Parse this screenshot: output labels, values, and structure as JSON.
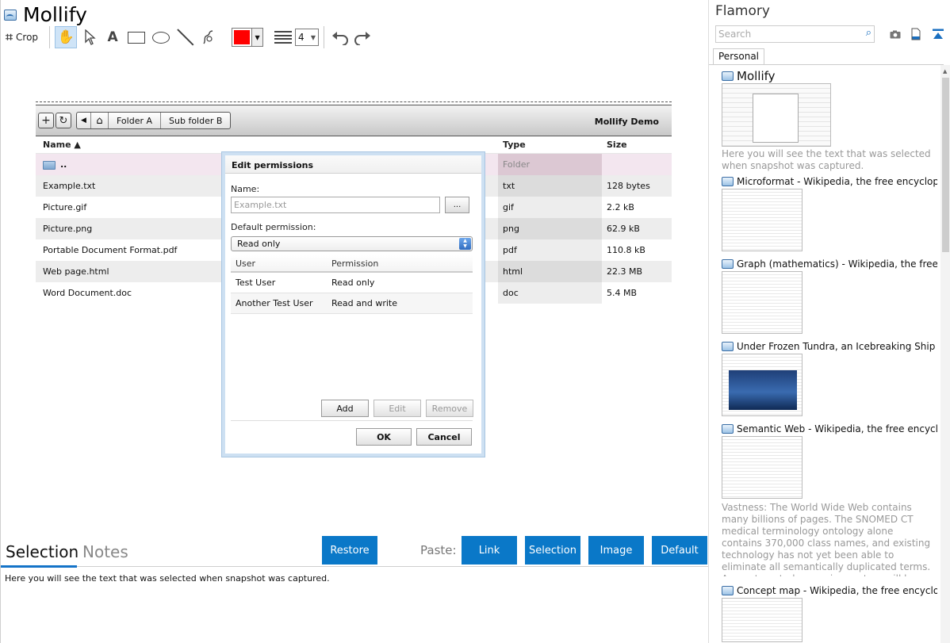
{
  "app": {
    "title": "Mollify"
  },
  "toolbar": {
    "crop_label": "Crop",
    "text_tool_glyph": "A",
    "color_hex": "#ff0000",
    "line_width": "4"
  },
  "file_manager": {
    "breadcrumb": [
      "Folder A",
      "Sub folder B"
    ],
    "brand": "Mollify Demo",
    "columns": {
      "name": "Name ▲",
      "type": "Type",
      "size": "Size"
    },
    "parent_name": "..",
    "parent_type": "Folder",
    "files": [
      {
        "name": "Example.txt",
        "type": "txt",
        "size": "128 bytes"
      },
      {
        "name": "Picture.gif",
        "type": "gif",
        "size": "2.2 kB"
      },
      {
        "name": "Picture.png",
        "type": "png",
        "size": "62.9 kB"
      },
      {
        "name": "Portable Document Format.pdf",
        "type": "pdf",
        "size": "110.8 kB"
      },
      {
        "name": "Web page.html",
        "type": "html",
        "size": "22.3 MB"
      },
      {
        "name": "Word Document.doc",
        "type": "doc",
        "size": "5.4 MB"
      }
    ]
  },
  "dialog": {
    "title": "Edit permissions",
    "name_label": "Name:",
    "name_placeholder": "Example.txt",
    "browse_label": "...",
    "default_label": "Default permission:",
    "default_value": "Read only",
    "col_user": "User",
    "col_permission": "Permission",
    "rows": [
      {
        "user": "Test User",
        "permission": "Read only"
      },
      {
        "user": "Another Test User",
        "permission": "Read and write"
      }
    ],
    "add": "Add",
    "edit": "Edit",
    "remove": "Remove",
    "ok": "OK",
    "cancel": "Cancel"
  },
  "bottom": {
    "tab_selection": "Selection",
    "tab_notes": "Notes",
    "restore": "Restore",
    "paste_label": "Paste:",
    "paste_link": "Link",
    "paste_selection": "Selection",
    "paste_image": "Image",
    "paste_default": "Default",
    "snapshot_text": "Here you will see the text that was selected when snapshot was captured."
  },
  "sidebar": {
    "title": "Flamory",
    "search_placeholder": "Search",
    "tab_personal": "Personal",
    "entries": [
      {
        "title": "Mollify",
        "desc": "Here you will see the text that was selected when snapshot was captured."
      },
      {
        "title": "Microformat - Wikipedia, the free encyclopedia"
      },
      {
        "title": "Graph (mathematics) - Wikipedia, the free ency"
      },
      {
        "title": "Under Frozen Tundra, an Icebreaking Ship Unco"
      },
      {
        "title": "Semantic Web - Wikipedia, the free encycloped",
        "desc": "Vastness: The World Wide Web contains many billions of pages. The SNOMED CT medical terminology ontology alone contains 370,000 class names, and existing technology has not yet been able to eliminate all semantically duplicated terms. Any automated reasoning system will have to deal with truly huge inputs."
      },
      {
        "title": "Concept map - Wikipedia, the free encyclopedi"
      }
    ]
  }
}
